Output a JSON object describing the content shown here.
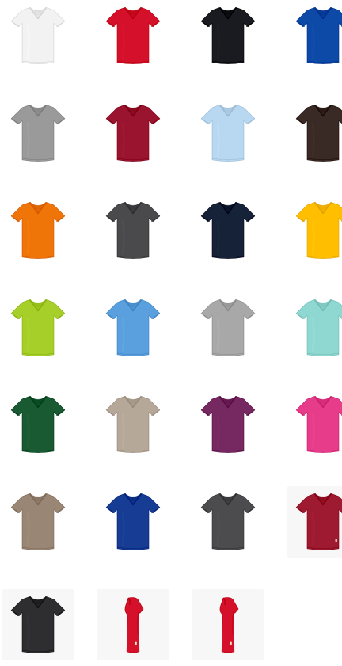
{
  "products": [
    {
      "color": "#f2f2f2",
      "view": "front"
    },
    {
      "color": "#d4102b",
      "view": "front"
    },
    {
      "color": "#1a1b20",
      "view": "front"
    },
    {
      "color": "#0d4aa8",
      "view": "front"
    },
    {
      "color": "#9a9a9a",
      "view": "front"
    },
    {
      "color": "#9a1430",
      "view": "front"
    },
    {
      "color": "#b8d8f2",
      "view": "front"
    },
    {
      "color": "#3a2a26",
      "view": "front"
    },
    {
      "color": "#f07508",
      "view": "front"
    },
    {
      "color": "#4a4a4c",
      "view": "front"
    },
    {
      "color": "#162238",
      "view": "front"
    },
    {
      "color": "#ffbf00",
      "view": "front"
    },
    {
      "color": "#a6cf2a",
      "view": "front"
    },
    {
      "color": "#5aa0de",
      "view": "front"
    },
    {
      "color": "#a8a8a8",
      "view": "front"
    },
    {
      "color": "#8fd8d2",
      "view": "front"
    },
    {
      "color": "#195a33",
      "view": "front"
    },
    {
      "color": "#b6a898",
      "view": "front"
    },
    {
      "color": "#762860",
      "view": "front"
    },
    {
      "color": "#e63c8a",
      "view": "front"
    },
    {
      "color": "#9a8674",
      "view": "front"
    },
    {
      "color": "#173c94",
      "view": "front"
    },
    {
      "color": "#4c4c4e",
      "view": "front"
    },
    {
      "color": "#9e1a30",
      "view": "front-detail",
      "framed": true
    },
    {
      "color": "#2e2e30",
      "view": "front",
      "framed": true
    },
    {
      "color": "#d4102b",
      "view": "side",
      "framed": true
    },
    {
      "color": "#d4102b",
      "view": "side",
      "framed": true
    }
  ]
}
